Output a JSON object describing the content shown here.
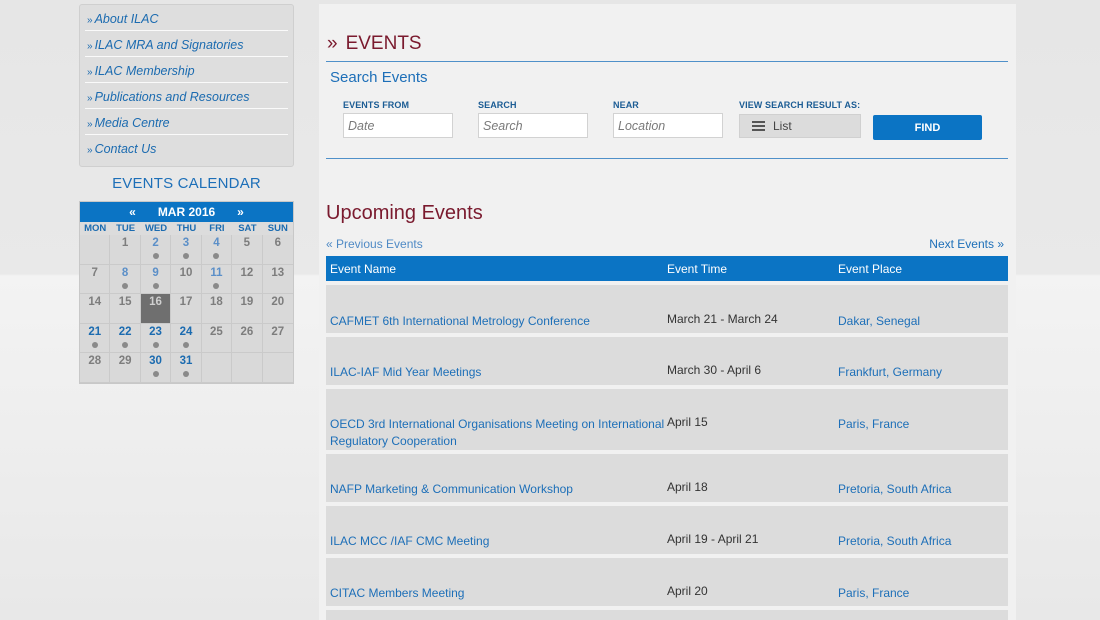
{
  "sidebar": {
    "items": [
      {
        "label": "About ILAC"
      },
      {
        "label": "ILAC MRA and Signatories"
      },
      {
        "label": "ILAC Membership"
      },
      {
        "label": "Publications and Resources"
      },
      {
        "label": "Media Centre"
      },
      {
        "label": "Contact Us"
      }
    ],
    "chevron": "»"
  },
  "calendar": {
    "title": "EVENTS CALENDAR",
    "prev": "«",
    "next": "»",
    "month": "MAR 2016",
    "dow": [
      "MON",
      "TUE",
      "WED",
      "THU",
      "FRI",
      "SAT",
      "SUN"
    ],
    "days": [
      {
        "d": "",
        "e": false
      },
      {
        "d": "1",
        "e": false
      },
      {
        "d": "2",
        "e": true
      },
      {
        "d": "3",
        "e": true
      },
      {
        "d": "4",
        "e": true
      },
      {
        "d": "5",
        "e": false
      },
      {
        "d": "6",
        "e": false
      },
      {
        "d": "7",
        "e": false
      },
      {
        "d": "8",
        "e": true
      },
      {
        "d": "9",
        "e": true
      },
      {
        "d": "10",
        "e": false
      },
      {
        "d": "11",
        "e": true
      },
      {
        "d": "12",
        "e": false
      },
      {
        "d": "13",
        "e": false
      },
      {
        "d": "14",
        "e": false
      },
      {
        "d": "15",
        "e": false
      },
      {
        "d": "16",
        "e": false,
        "today": true
      },
      {
        "d": "17",
        "e": false
      },
      {
        "d": "18",
        "e": false
      },
      {
        "d": "19",
        "e": false
      },
      {
        "d": "20",
        "e": false
      },
      {
        "d": "21",
        "e": true,
        "b": true
      },
      {
        "d": "22",
        "e": true,
        "b": true
      },
      {
        "d": "23",
        "e": true,
        "b": true
      },
      {
        "d": "24",
        "e": true,
        "b": true
      },
      {
        "d": "25",
        "e": false
      },
      {
        "d": "26",
        "e": false
      },
      {
        "d": "27",
        "e": false
      },
      {
        "d": "28",
        "e": false
      },
      {
        "d": "29",
        "e": false
      },
      {
        "d": "30",
        "e": true,
        "b": true
      },
      {
        "d": "31",
        "e": true,
        "b": true
      },
      {
        "d": "",
        "e": false
      },
      {
        "d": "",
        "e": false
      },
      {
        "d": "",
        "e": false
      }
    ]
  },
  "main": {
    "title_prefix": "»",
    "title": "EVENTS",
    "search_title": "Search Events",
    "fields": {
      "from_label": "EVENTS FROM",
      "from_placeholder": "Date",
      "search_label": "SEARCH",
      "search_placeholder": "Search",
      "near_label": "NEAR",
      "near_placeholder": "Location",
      "view_label": "VIEW SEARCH RESULT AS:",
      "view_value": "List",
      "find_label": "FIND"
    },
    "upcoming_title": "Upcoming Events",
    "prev_link": "« Previous Events",
    "next_link": "Next Events »",
    "columns": [
      "Event Name",
      "Event Time",
      "Event Place"
    ],
    "events": [
      {
        "name": "CAFMET 6th International Metrology Conference",
        "time": "March 21 - March 24",
        "place": "Dakar, Senegal"
      },
      {
        "name": "ILAC-IAF Mid Year Meetings",
        "time": "March 30 - April 6",
        "place": "Frankfurt, Germany"
      },
      {
        "name": "OECD 3rd International Organisations Meeting on International Regulatory Cooperation",
        "time": "April 15",
        "place": "Paris, France"
      },
      {
        "name": "NAFP Marketing & Communication Workshop",
        "time": "April 18",
        "place": "Pretoria, South Africa"
      },
      {
        "name": "ILAC MCC /IAF CMC Meeting",
        "time": "April 19 - April 21",
        "place": "Pretoria, South Africa"
      },
      {
        "name": "CITAC Members Meeting",
        "time": "April 20",
        "place": "Paris, France"
      }
    ]
  }
}
